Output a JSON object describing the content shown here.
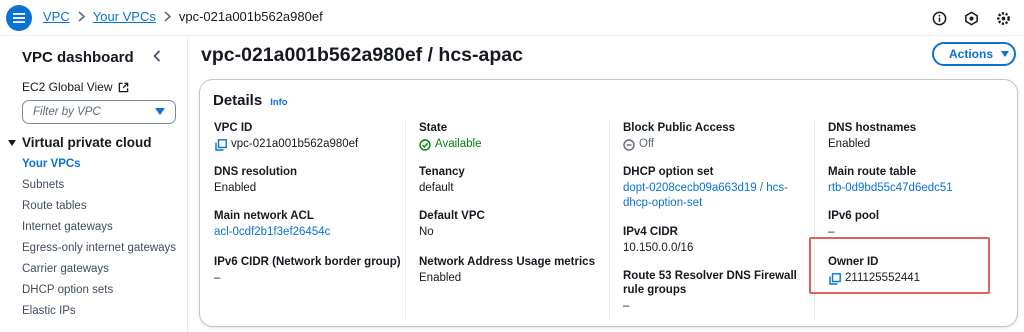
{
  "breadcrumb": {
    "items": [
      "VPC",
      "Your VPCs"
    ],
    "current": "vpc-021a001b562a980ef"
  },
  "top_icons": [
    "info-circle-icon",
    "notification-icon",
    "settings-icon"
  ],
  "sidebar": {
    "title": "VPC dashboard",
    "ec2_link": "EC2 Global View",
    "filter_placeholder": "Filter by VPC",
    "section": "Virtual private cloud",
    "items": [
      {
        "label": "Your VPCs",
        "active": true
      },
      {
        "label": "Subnets"
      },
      {
        "label": "Route tables"
      },
      {
        "label": "Internet gateways"
      },
      {
        "label": "Egress-only internet gateways"
      },
      {
        "label": "Carrier gateways"
      },
      {
        "label": "DHCP option sets"
      },
      {
        "label": "Elastic IPs"
      }
    ]
  },
  "page": {
    "title": "vpc-021a001b562a980ef / hcs-apac",
    "actions_label": "Actions"
  },
  "details": {
    "heading": "Details",
    "info_label": "Info",
    "col1": {
      "vpc_id": {
        "label": "VPC ID",
        "value": "vpc-021a001b562a980ef"
      },
      "dns_resolution": {
        "label": "DNS resolution",
        "value": "Enabled"
      },
      "main_acl": {
        "label": "Main network ACL",
        "value": "acl-0cdf2b1f3ef26454c"
      },
      "ipv6_cidr_nbg": {
        "label": "IPv6 CIDR (Network border group)",
        "value": "–"
      }
    },
    "col2": {
      "state": {
        "label": "State",
        "value": "Available"
      },
      "tenancy": {
        "label": "Tenancy",
        "value": "default"
      },
      "default_vpc": {
        "label": "Default VPC",
        "value": "No"
      },
      "nau_metrics": {
        "label": "Network Address Usage metrics",
        "value": "Enabled"
      }
    },
    "col3": {
      "block_public_access": {
        "label": "Block Public Access",
        "value": "Off"
      },
      "dhcp_option_set": {
        "label": "DHCP option set",
        "value_line1": "dopt-0208cecb09a663d19 / hcs-",
        "value_line2": "dhcp-option-set"
      },
      "ipv4_cidr": {
        "label": "IPv4 CIDR",
        "value": "10.150.0.0/16"
      },
      "route53_firewall": {
        "label_line1": "Route 53 Resolver DNS Firewall",
        "label_line2": "rule groups",
        "value": "–"
      }
    },
    "col4": {
      "dns_hostnames": {
        "label": "DNS hostnames",
        "value": "Enabled"
      },
      "main_route_table": {
        "label": "Main route table",
        "value": "rtb-0d9bd55c47d6edc51"
      },
      "ipv6_pool": {
        "label": "IPv6 pool",
        "value": "–"
      },
      "owner_id": {
        "label": "Owner ID",
        "value": "211125552441"
      }
    }
  },
  "colors": {
    "link": "#0972d3",
    "available": "#037f0c",
    "highlight_box": "#e0625b"
  }
}
